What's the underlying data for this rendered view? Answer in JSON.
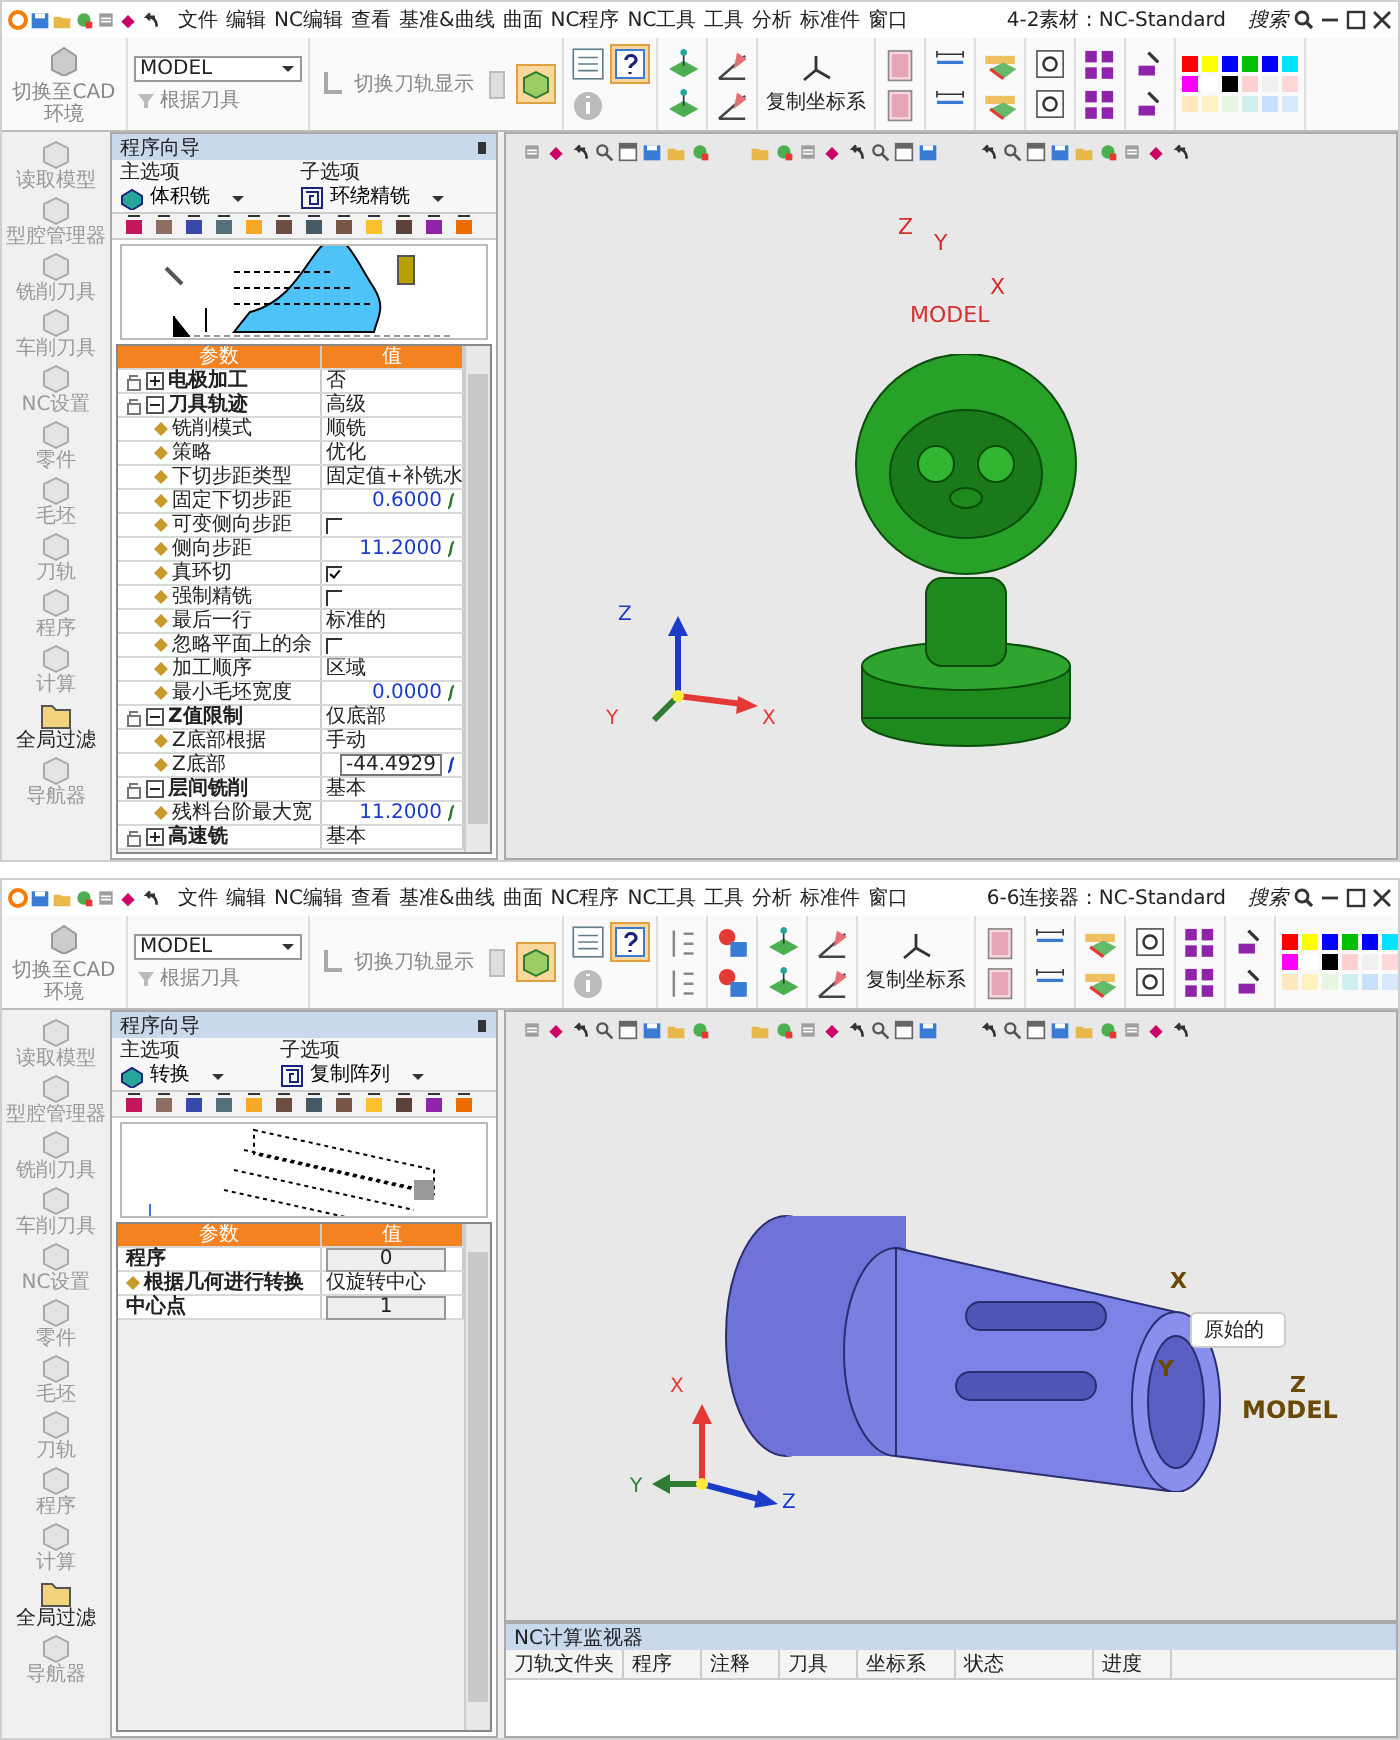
{
  "screens": [
    {
      "title": "4-2素材 : NC-Standard",
      "search": "搜索",
      "menu": [
        "文件",
        "编辑",
        "NC编辑",
        "查看",
        "基准&曲线",
        "曲面",
        "NC程序",
        "NC工具",
        "工具",
        "分析",
        "标准件",
        "窗口"
      ],
      "ribbon": [
        {
          "kind": "cad",
          "label": "切换至CAD环境"
        },
        {
          "kind": "model",
          "value": "MODEL",
          "label": "根据刀具"
        },
        {
          "kind": "toolpath",
          "label": "切换刀轨显示"
        },
        {
          "kind": "info"
        },
        {
          "kind": "plane"
        },
        {
          "kind": "sketch"
        },
        {
          "kind": "csys",
          "label": "复制坐标系"
        },
        {
          "kind": "frame"
        },
        {
          "kind": "text"
        },
        {
          "kind": "measure"
        },
        {
          "kind": "zoom"
        },
        {
          "kind": "transform"
        },
        {
          "kind": "paint"
        },
        {
          "kind": "palette"
        }
      ],
      "sidebar": [
        {
          "label": "读取模型",
          "disabled": true
        },
        {
          "label": "型腔管理器",
          "disabled": true
        },
        {
          "label": "铣削刀具",
          "disabled": true
        },
        {
          "label": "车削刀具",
          "disabled": true
        },
        {
          "label": "NC设置",
          "disabled": true
        },
        {
          "label": "零件",
          "disabled": true
        },
        {
          "label": "毛坯",
          "disabled": true
        },
        {
          "label": "刀轨",
          "disabled": true
        },
        {
          "label": "程序",
          "disabled": true
        },
        {
          "label": "计算",
          "disabled": true
        },
        {
          "label": "全局过滤",
          "disabled": false
        },
        {
          "label": "导航器",
          "disabled": true
        }
      ],
      "panel": {
        "title": "程序向导",
        "main_label": "主选项",
        "main_value": "体积铣",
        "sub_label": "子选项",
        "sub_value": "环绕精铣",
        "preview": {
          "kind": "profile"
        },
        "columns": [
          "参数",
          "值"
        ],
        "rows": [
          {
            "kind": "group",
            "label": "电极加工",
            "value": "否",
            "expanded": false,
            "children": []
          },
          {
            "kind": "group",
            "label": "刀具轨迹",
            "value": "高级",
            "expanded": true,
            "children": [
              {
                "kind": "text",
                "label": "铣削模式",
                "value": "顺铣"
              },
              {
                "kind": "text",
                "label": "策略",
                "value": "优化"
              },
              {
                "kind": "text",
                "label": "下切步距类型",
                "value": "固定值+补铣水"
              },
              {
                "kind": "number",
                "label": "固定下切步距",
                "value": "0.6000"
              },
              {
                "kind": "check",
                "label": "可变侧向步距",
                "checked": false
              },
              {
                "kind": "number",
                "label": "侧向步距",
                "value": "11.2000"
              },
              {
                "kind": "check",
                "label": "真环切",
                "checked": true
              },
              {
                "kind": "check",
                "label": "强制精铣",
                "checked": false
              },
              {
                "kind": "text",
                "label": "最后一行",
                "value": "标准的"
              },
              {
                "kind": "check",
                "label": "忽略平面上的余",
                "checked": false
              },
              {
                "kind": "text",
                "label": "加工顺序",
                "value": "区域"
              },
              {
                "kind": "number",
                "label": "最小毛坯宽度",
                "value": "0.0000"
              }
            ]
          },
          {
            "kind": "group",
            "label": "Z值限制",
            "value": "仅底部",
            "expanded": true,
            "children": [
              {
                "kind": "text",
                "label": "Z底部根据",
                "value": "手动"
              },
              {
                "kind": "edit",
                "label": "Z底部",
                "value": "-44.4929"
              }
            ]
          },
          {
            "kind": "group",
            "label": "层间铣削",
            "value": "基本",
            "expanded": true,
            "children": [
              {
                "kind": "number",
                "label": "残料台阶最大宽",
                "value": "11.2000"
              }
            ]
          },
          {
            "kind": "group",
            "label": "高速铣",
            "value": "基本",
            "expanded": false,
            "children": []
          }
        ]
      },
      "viewport": {
        "model": {
          "kind": "figurine"
        },
        "csys_labels": [
          "Z",
          "Y",
          "X"
        ],
        "csys_name": "MODEL",
        "triad": {
          "kind": "zyx",
          "labels": [
            "Z",
            "Y",
            "X"
          ]
        }
      }
    },
    {
      "title": "6-6连接器 : NC-Standard",
      "search": "搜索",
      "menu": [
        "文件",
        "编辑",
        "NC编辑",
        "查看",
        "基准&曲线",
        "曲面",
        "NC程序",
        "NC工具",
        "工具",
        "分析",
        "标准件",
        "窗口"
      ],
      "ribbon": [
        {
          "kind": "cad",
          "label": "切换至CAD环境"
        },
        {
          "kind": "model",
          "value": "MODEL",
          "label": "根据刀具"
        },
        {
          "kind": "toolpath",
          "label": "切换刀轨显示"
        },
        {
          "kind": "info"
        },
        {
          "kind": "list"
        },
        {
          "kind": "shapes"
        },
        {
          "kind": "plane"
        },
        {
          "kind": "sketch"
        },
        {
          "kind": "csys",
          "label": "复制坐标系"
        },
        {
          "kind": "frame"
        },
        {
          "kind": "text"
        },
        {
          "kind": "measure"
        },
        {
          "kind": "zoom"
        },
        {
          "kind": "transform"
        },
        {
          "kind": "paint"
        },
        {
          "kind": "palette"
        }
      ],
      "sidebar": [
        {
          "label": "读取模型",
          "disabled": true
        },
        {
          "label": "型腔管理器",
          "disabled": true
        },
        {
          "label": "铣削刀具",
          "disabled": true
        },
        {
          "label": "车削刀具",
          "disabled": true
        },
        {
          "label": "NC设置",
          "disabled": true
        },
        {
          "label": "零件",
          "disabled": true
        },
        {
          "label": "毛坯",
          "disabled": true
        },
        {
          "label": "刀轨",
          "disabled": true
        },
        {
          "label": "程序",
          "disabled": true
        },
        {
          "label": "计算",
          "disabled": true
        },
        {
          "label": "全局过滤",
          "disabled": false
        },
        {
          "label": "导航器",
          "disabled": true
        }
      ],
      "panel": {
        "title": "程序向导",
        "main_label": "主选项",
        "main_value": "转换",
        "sub_label": "子选项",
        "sub_value": "复制阵列",
        "preview": {
          "kind": "pattern"
        },
        "columns": [
          "参数",
          "值"
        ],
        "rows": [
          {
            "kind": "spin",
            "label": "程序",
            "value": "0"
          },
          {
            "kind": "text",
            "label": "根据几何进行转换",
            "value": "仅旋转中心"
          },
          {
            "kind": "spin",
            "label": "中心点",
            "value": "1"
          }
        ]
      },
      "viewport": {
        "model": {
          "kind": "connector"
        },
        "csys_labels": [
          "X",
          "Y",
          "Z"
        ],
        "csys_name": "MODEL",
        "tooltip": "原始的",
        "triad": {
          "kind": "xyz",
          "labels": [
            "X",
            "Y",
            "Z"
          ]
        }
      },
      "monitor": {
        "title": "NC计算监视器",
        "columns": [
          "刀轨文件夹",
          "程序",
          "注释",
          "刀具",
          "坐标系",
          "状态",
          "进度"
        ]
      }
    }
  ]
}
